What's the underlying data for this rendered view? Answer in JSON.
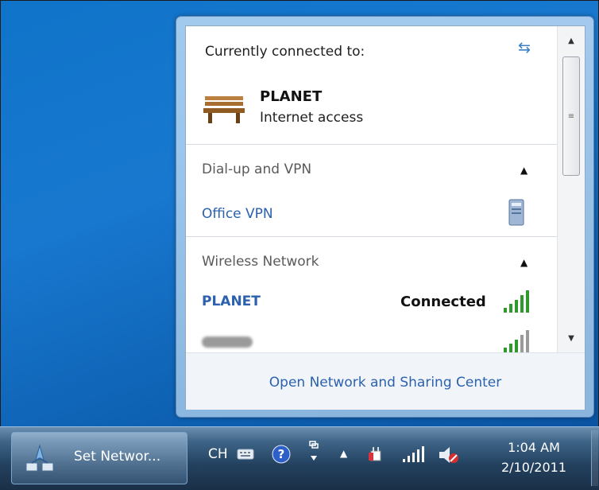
{
  "flyout": {
    "connected_to_label": "Currently connected to:",
    "current_network": {
      "name": "PLANET",
      "status": "Internet access"
    },
    "sections": [
      {
        "header": "Dial-up and VPN",
        "items": [
          {
            "name": "Office VPN"
          }
        ]
      },
      {
        "header": "Wireless Network",
        "items": [
          {
            "name": "PLANET",
            "status": "Connected"
          }
        ]
      }
    ],
    "footer_link": "Open Network and Sharing Center"
  },
  "taskbar": {
    "button_label": "Set Networ...",
    "language": "CH",
    "clock": {
      "time": "1:04 AM",
      "date": "2/10/2011"
    }
  },
  "colors": {
    "link": "#2b61ad",
    "desktop": "#1273c6",
    "signal_green": "#2f9a2c"
  }
}
